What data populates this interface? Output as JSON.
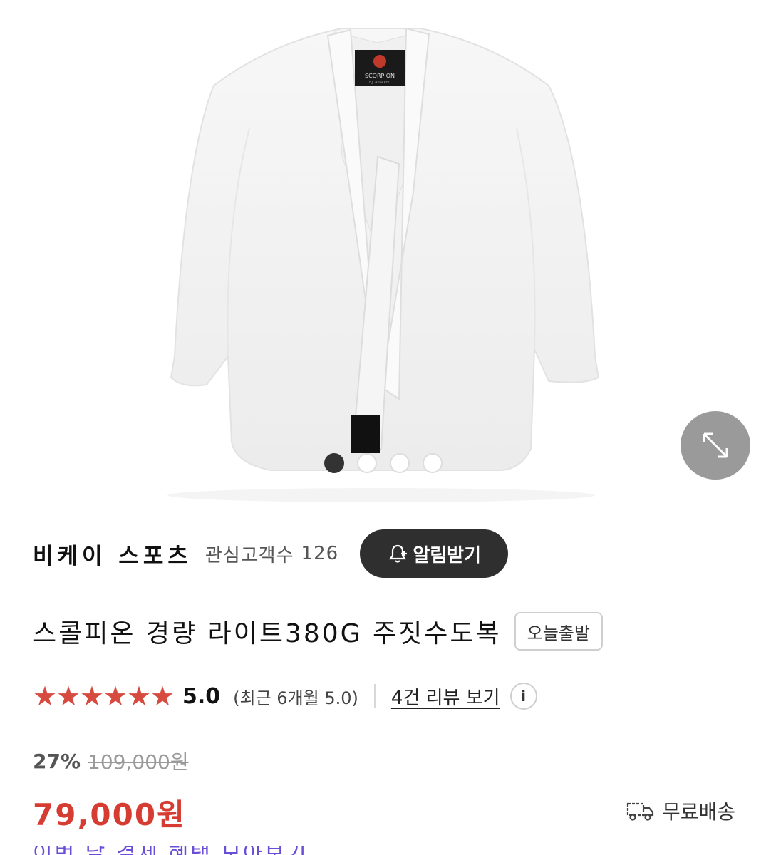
{
  "gallery": {
    "logo_text": "SCORPION",
    "logo_subtext": "BJJ APPAREL",
    "dots": [
      {
        "active": true
      },
      {
        "active": false
      },
      {
        "active": false
      },
      {
        "active": false
      }
    ]
  },
  "seller": {
    "name": "비케이 스포츠",
    "fans_label": "관심고객수",
    "fans_count": "126",
    "notify_label": "알림받기"
  },
  "product": {
    "title": "스콜피온 경량 라이트380G 주짓수도복",
    "badge": "오늘출발"
  },
  "rating": {
    "stars": 5,
    "score": "5.0",
    "recent": "(최근 6개월 5.0)",
    "reviews_link": "4건 리뷰 보기",
    "info": "i"
  },
  "pricing": {
    "discount": "27%",
    "original_price": "109,000원",
    "price": "79,000원",
    "shipping": "무료배송"
  },
  "colors": {
    "price": "#d63c32",
    "star": "#d64a3f",
    "button_dark": "#2f2f2f"
  },
  "bottom_peek": "이번 달 결제 혜택 모아보기"
}
